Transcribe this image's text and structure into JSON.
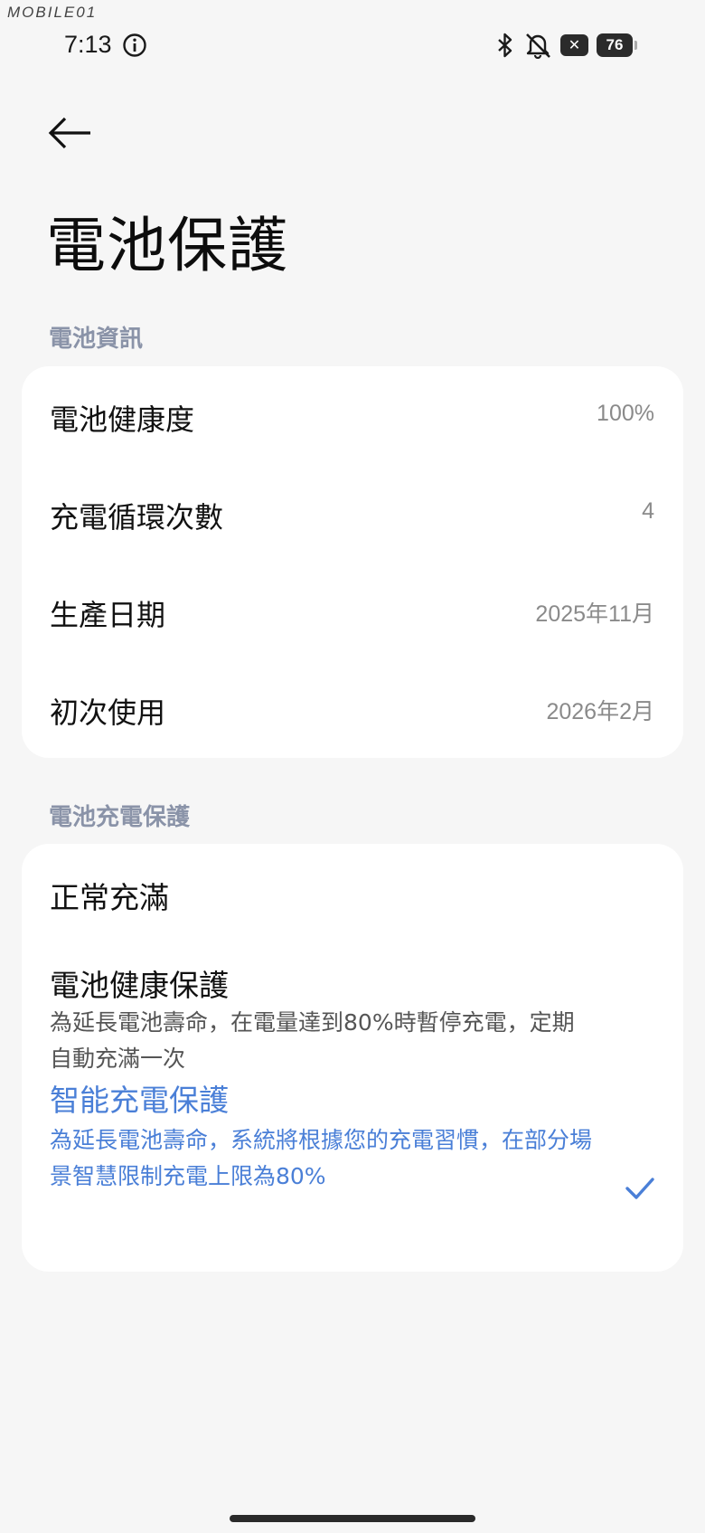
{
  "watermark": "MOBILE01",
  "status_bar": {
    "time": "7:13",
    "x_badge": "✕",
    "battery_level": "76"
  },
  "header": {
    "title": "電池保護"
  },
  "battery_info": {
    "section_label": "電池資訊",
    "rows": [
      {
        "label": "電池健康度",
        "value": "100%"
      },
      {
        "label": "充電循環次數",
        "value": "4"
      },
      {
        "label": "生產日期",
        "value": "2025年11月"
      },
      {
        "label": "初次使用",
        "value": "2026年2月"
      }
    ]
  },
  "charge_protection": {
    "section_label": "電池充電保護",
    "options": [
      {
        "title": "正常充滿",
        "description": ""
      },
      {
        "title": "電池健康保護",
        "description": "為延長電池壽命，在電量達到80%時暫停充電，定期自動充滿一次"
      },
      {
        "title": "智能充電保護",
        "description": "為延長電池壽命，系統將根據您的充電習慣，在部分場景智慧限制充電上限為80%",
        "selected": true
      }
    ]
  },
  "colors": {
    "accent": "#4a7fd7",
    "section_label": "#8a93a8",
    "background": "#f6f6f6"
  }
}
